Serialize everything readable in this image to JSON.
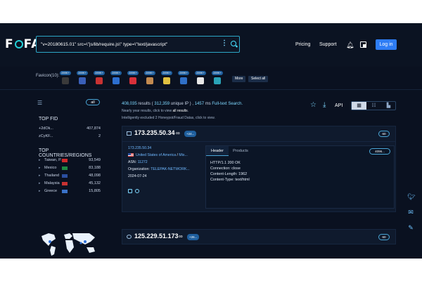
{
  "header": {
    "logo": "FOFA",
    "search_value": "\"v=20180615.01\" src=\\\"js/lib/require.js\\\" type=\\\"text/javascript\"",
    "nav": {
      "pricing": "Pricing",
      "support": "Support"
    },
    "login_label": "Log in"
  },
  "favicon_bar": {
    "label": "Favicon(10):",
    "items": [
      {
        "count": "289K+",
        "icon": "circle-icon",
        "color": "#3a3a3a"
      },
      {
        "count": "289K+",
        "icon": "m-logo-icon",
        "color": "#3a5fb8"
      },
      {
        "count": "289K+",
        "icon": "red-grid-icon",
        "color": "#c83232"
      },
      {
        "count": "289K+",
        "icon": "blue-cube-icon",
        "color": "#2d6fd0"
      },
      {
        "count": "289K+",
        "icon": "angular-icon",
        "color": "#d8303a"
      },
      {
        "count": "289K+",
        "icon": "avatar-icon",
        "color": "#c28a50"
      },
      {
        "count": "289K+",
        "icon": "yellow-circle-icon",
        "color": "#e0c040"
      },
      {
        "count": "289K+",
        "icon": "blue-square-icon",
        "color": "#3070c8"
      },
      {
        "count": "289K+",
        "icon": "white-card-icon",
        "color": "#e8e8e8"
      },
      {
        "count": "289K+",
        "icon": "teal-box-icon",
        "color": "#2aa4b8"
      }
    ],
    "more_label": "More",
    "select_all_label": "Select all"
  },
  "sidebar": {
    "all_label": "all",
    "top_fid_title": "TOP FID",
    "fid": [
      {
        "name": "+2dOk...",
        "count": "407,874"
      },
      {
        "name": "zCyKF...",
        "count": "2"
      }
    ],
    "top_countries_title": "TOP COUNTRIES/REGIONS",
    "countries": [
      {
        "name": "Taiwan, P...",
        "count": "93,549",
        "flag": "#d02a2a"
      },
      {
        "name": "Mexico",
        "count": "83,188",
        "flag": "#1e8a44"
      },
      {
        "name": "Thailand",
        "count": "48,098",
        "flag": "#2b4fa0"
      },
      {
        "name": "Malaysia",
        "count": "45,132",
        "flag": "#c83232"
      },
      {
        "name": "Greece",
        "count": "15,805",
        "flag": "#3a72c8"
      }
    ]
  },
  "results": {
    "count": "408,035",
    "results_label": "results",
    "unique_ip": "312,359",
    "unique_ip_label": "unique IP",
    "time": "1457",
    "ms_label": "ms",
    "fulltext": "Full-text Search.",
    "near_year_prefix": "Nearly year results, click to view",
    "all_results": "all results",
    "excluded_prefix": "Intelligently excluded 2 Honeypot/Fraud Datas, click to view.",
    "api_label": "API"
  },
  "card1": {
    "ip": "173.235.50.34",
    "plus": "+24...",
    "count": "60",
    "host_link": "173.235.50.34",
    "country": "United States of America",
    "region": "Mis...",
    "asn_label": "ASN:",
    "asn": "11272",
    "org_label": "Organization:",
    "org": "TELEPAK-NETWORK...",
    "date": "2024-07-24",
    "tab_header": "Header",
    "tab_products": "Products",
    "port": "4096...",
    "headers": "HTTP/1.1 200 OK\nConnection: close\nContent-Length: 1962\nContent-Type: text/html"
  },
  "card2": {
    "ip": "125.229.51.173",
    "plus": "+26...",
    "count": "60"
  }
}
